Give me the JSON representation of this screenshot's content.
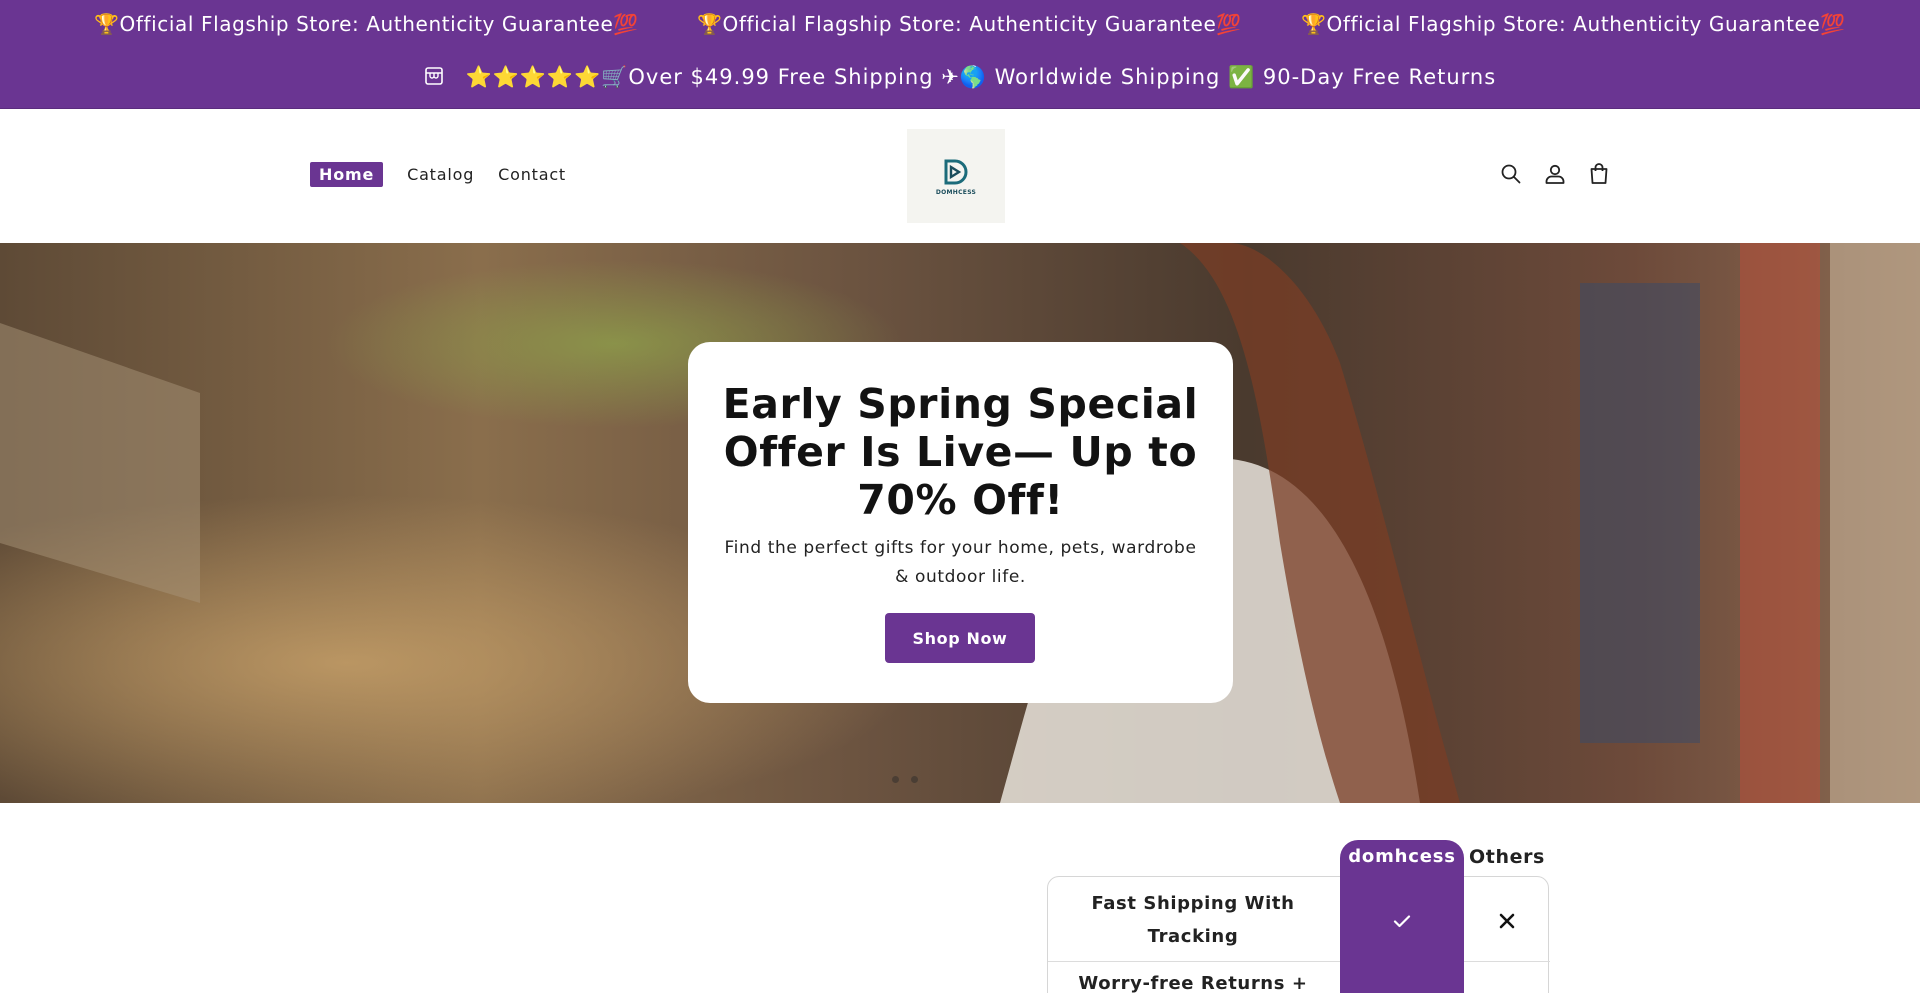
{
  "marquee": {
    "items": [
      "🏆Official Flagship Store: Authenticity Guarantee💯",
      "🏆Official Flagship Store: Authenticity Guarantee💯",
      "🏆Official Flagship Store: Authenticity Guarantee💯"
    ]
  },
  "announcement": {
    "icon": "store-icon",
    "text": "⭐⭐⭐⭐⭐🛒Over $49.99 Free Shipping ✈🌎 Worldwide Shipping ✅ 90-Day Free Returns"
  },
  "nav": {
    "items": [
      "Home",
      "Catalog",
      "Contact"
    ],
    "active": "Home"
  },
  "logo": {
    "text": "DOMHCESS"
  },
  "header_icons": [
    "search-icon",
    "account-icon",
    "cart-icon"
  ],
  "hero": {
    "title": "Early Spring Special Offer Is Live— Up to 70% Off!",
    "subtitle": "Find the perfect gifts for your home, pets, wardrobe & outdoor life.",
    "button": "Shop Now",
    "slide_count": 2
  },
  "compare": {
    "brand": "domhcess",
    "others": "Others",
    "rows": [
      {
        "feature": "Fast Shipping With Tracking",
        "brand": "check-icon",
        "others": "cross-icon"
      },
      {
        "feature": "Worry-free Returns +"
      }
    ]
  },
  "colors": {
    "accent": "#6a3592",
    "white": "#ffffff"
  }
}
